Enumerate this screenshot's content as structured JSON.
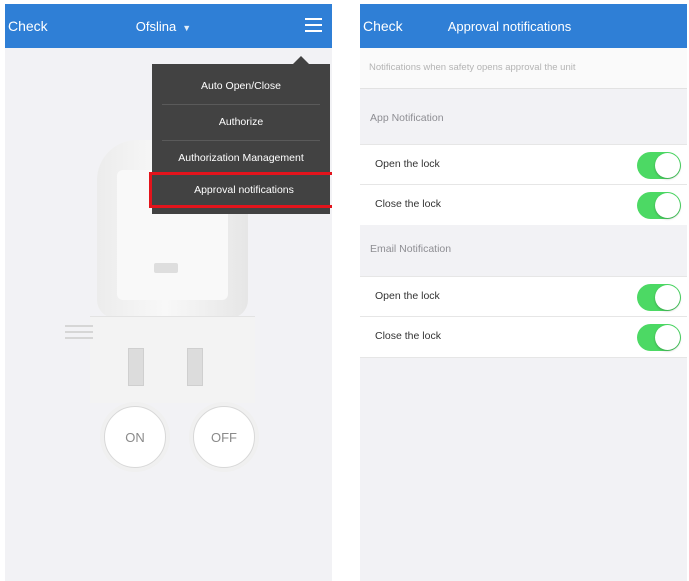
{
  "left": {
    "nav": {
      "back": "Check",
      "title": "Ofslina"
    },
    "menu": {
      "items": [
        "Auto Open/Close",
        "Authorize",
        "Authorization Management",
        "Approval notifications"
      ]
    },
    "buttons": {
      "on": "ON",
      "off": "OFF"
    }
  },
  "right": {
    "nav": {
      "back": "Check",
      "title": "Approval notifications"
    },
    "subtitle": "Notifications when safety opens approval the unit",
    "sections": [
      {
        "header": "App Notification",
        "rows": [
          {
            "label": "Open the lock",
            "enabled": true
          },
          {
            "label": "Close the lock",
            "enabled": true
          }
        ]
      },
      {
        "header": "Email Notification",
        "rows": [
          {
            "label": "Open the lock",
            "enabled": true
          },
          {
            "label": "Close the lock",
            "enabled": true
          }
        ]
      }
    ]
  },
  "colors": {
    "nav": "#2f7fd6",
    "toggle_on": "#4cd964",
    "highlight": "#e3141c",
    "menu_bg": "#424242"
  }
}
